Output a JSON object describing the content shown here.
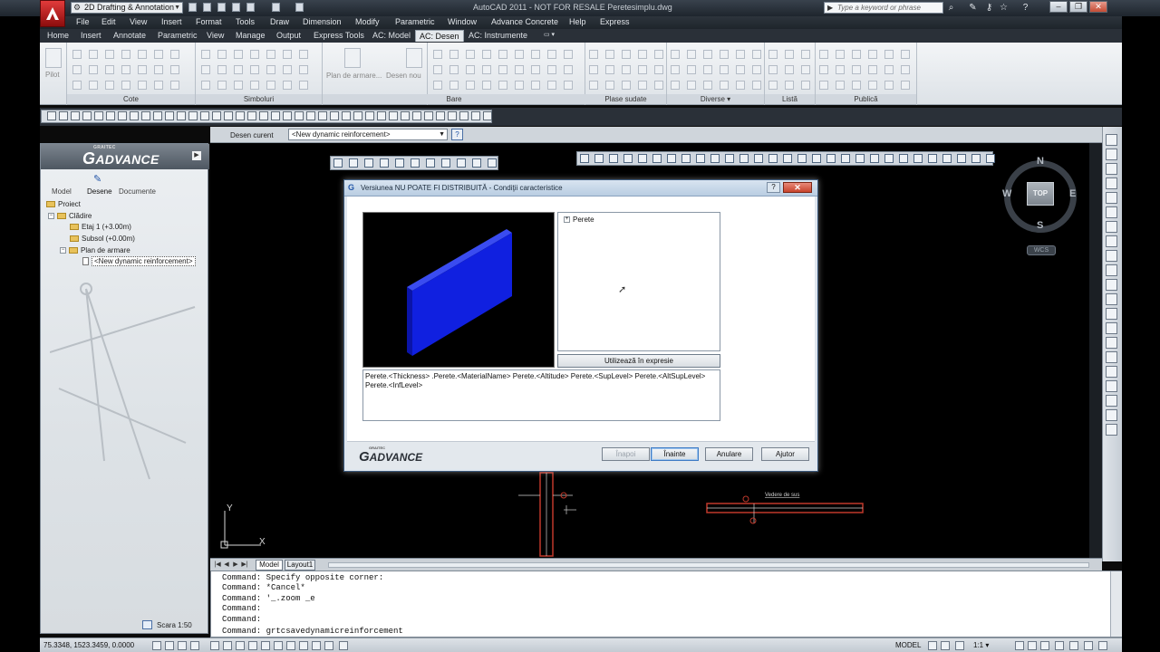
{
  "titlebar": {
    "workspace": "2D Drafting & Annotation",
    "title": "AutoCAD 2011 - NOT FOR RESALE   Peretesimplu.dwg",
    "search_placeholder": "Type a keyword or phrase"
  },
  "menu": [
    "File",
    "Edit",
    "View",
    "Insert",
    "Format",
    "Tools",
    "Draw",
    "Dimension",
    "Modify",
    "Parametric",
    "Window",
    "Advance Concrete",
    "Help",
    "Express"
  ],
  "ribbon_tabs": [
    "Home",
    "Insert",
    "Annotate",
    "Parametric",
    "View",
    "Manage",
    "Output",
    "Express Tools",
    "AC: Model",
    "AC: Desen",
    "AC: Instrumente"
  ],
  "ribbon_active_tab": "AC: Desen",
  "ribbon_panels": {
    "pilot": "Pilot",
    "cote": "Cote",
    "simboluri": "Simboluri",
    "plan_armare": "Plan de armare...",
    "desen_nou": "Desen nou",
    "bare": "Bare",
    "plase_sudate": "Plase sudate",
    "diverse": "Diverse ▾",
    "lista": "Listă",
    "publica": "Publică"
  },
  "palette": {
    "brand_small": "GRAITEC",
    "brand": "ADVANCE",
    "tabs": [
      "Model",
      "Desene",
      "Documente"
    ],
    "tree": {
      "proiect": "Proiect",
      "cladire": "Clădire",
      "etaj1": "Etaj 1 (+3.00m)",
      "subsol": "Subsol (+0.00m)",
      "plan_armare": "Plan de armare",
      "new_reinf": "<New dynamic reinforcement>"
    },
    "scale_label": "Scara",
    "scale_value": "1:50"
  },
  "desen_bar": {
    "label": "Desen curent",
    "value": "<New dynamic reinforcement>"
  },
  "compass": {
    "n": "N",
    "s": "S",
    "e": "E",
    "w": "W",
    "top": "TOP",
    "wcs": "WCS"
  },
  "dialog": {
    "title": "Versiunea NU POATE FI DISTRIBUITĂ - Condiţii caracteristice",
    "help": "?",
    "close": "✕",
    "tree_root": "Perete",
    "use_in_expression": "Utilizează în expresie",
    "expression_line1": "Perete.<Thickness> .Perete.<MaterialName> Perete.<Altitude> Perete.<SupLevel> Perete.<AltSupLevel>",
    "expression_line2": "Perete.<InfLevel>",
    "logo_small": "GRAITEC",
    "logo": "ADVANCE",
    "buttons": {
      "back": "Înapoi",
      "next": "Înainte",
      "cancel": "Anulare",
      "help": "Ajutor"
    },
    "preview_color": "#1020e0"
  },
  "canvas": {
    "annotation_top": "Vedere de sus",
    "ucs_y": "Y",
    "ucs_x": "X"
  },
  "layout_tabs": [
    "Model",
    "Layout1"
  ],
  "command_lines": [
    "Command: Specify opposite corner:",
    "Command: *Cancel*",
    "Command: '_.zoom _e",
    "Command:",
    "Command:",
    "Command: grtcsavedynamicreinforcement"
  ],
  "status": {
    "coords": "75.3348, 1523.3459, 0.0000",
    "model": "MODEL",
    "scale": "1:1 ▾"
  }
}
